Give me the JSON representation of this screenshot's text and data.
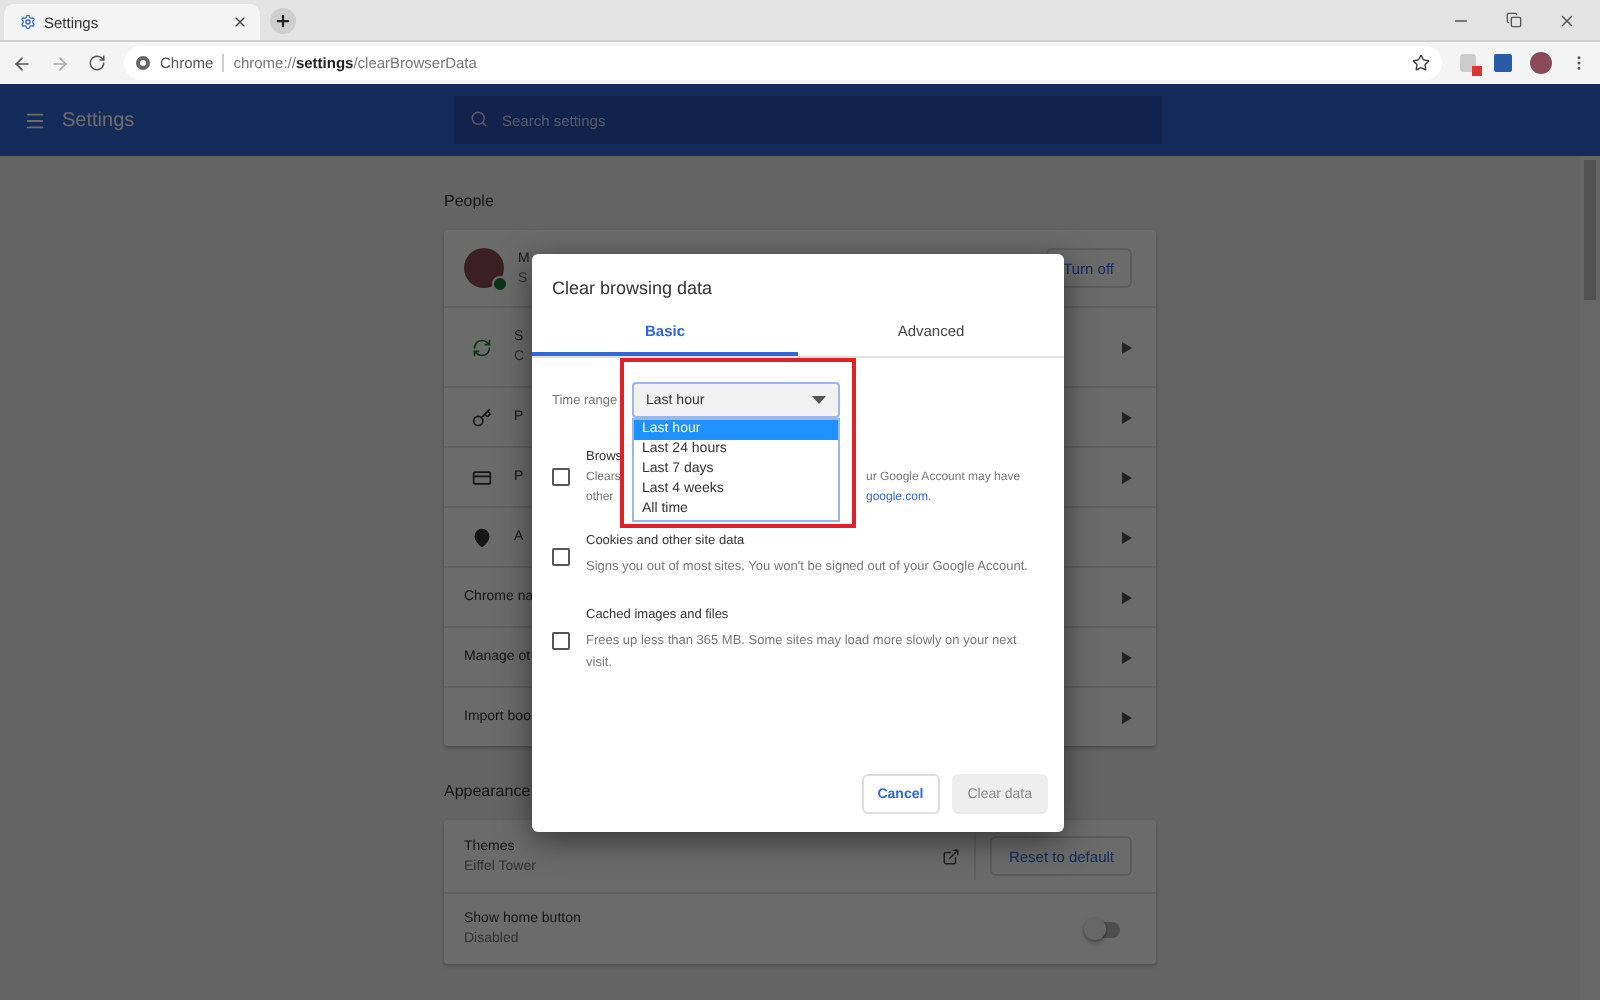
{
  "tab": {
    "title": "Settings"
  },
  "address_bar": {
    "chip": "Chrome",
    "url": "chrome://**settings**/clearBrowserData"
  },
  "header": {
    "title": "Settings",
    "search": {
      "placeholder": "Search settings"
    }
  },
  "people": {
    "heading": "People",
    "account": {
      "name": "M",
      "status": "S",
      "button": "Turn off"
    },
    "sync": {
      "title": "S",
      "subtitle": "C"
    },
    "passwords": {
      "title": "P"
    },
    "payment": {
      "title": "P"
    },
    "addresses": {
      "title": "A"
    },
    "links": [
      "Chrome na",
      "Manage ot",
      "Import boo"
    ]
  },
  "appearance": {
    "heading": "Appearance",
    "themes": {
      "title": "Themes",
      "value": "Eiffel Tower",
      "button": "Reset to default"
    },
    "home_button": {
      "title": "Show home button",
      "value": "Disabled",
      "on": false
    }
  },
  "dialog": {
    "title": "Clear browsing data",
    "tabs": [
      {
        "label": "Basic",
        "selected": true
      },
      {
        "label": "Advanced",
        "selected": false
      }
    ],
    "time_range": {
      "label": "Time range",
      "value": "Last hour",
      "options": [
        {
          "label": "Last hour",
          "selected": true
        },
        {
          "label": "Last 24 hours",
          "selected": false
        },
        {
          "label": "Last 7 days",
          "selected": false
        },
        {
          "label": "Last 4 weeks",
          "selected": false
        },
        {
          "label": "All time",
          "selected": false
        }
      ]
    },
    "items": [
      {
        "kind": "split",
        "title": "Brows",
        "checked": false,
        "lines": [
          {
            "left": "Clears",
            "right": "ur Google Account may have"
          },
          {
            "left": "other",
            "link": "google.com",
            "right": "."
          }
        ]
      },
      {
        "kind": "plain",
        "title": "Cookies and other site data",
        "description": "Signs you out of most sites. You won't be signed out of your Google Account.",
        "checked": false
      },
      {
        "kind": "plain",
        "title": "Cached images and files",
        "description": "Frees up less than 365 MB. Some sites may load more slowly on your next visit.",
        "checked": false
      }
    ],
    "buttons": [
      {
        "label": "Cancel",
        "disabled": false
      },
      {
        "label": "Clear data",
        "disabled": true
      }
    ]
  }
}
